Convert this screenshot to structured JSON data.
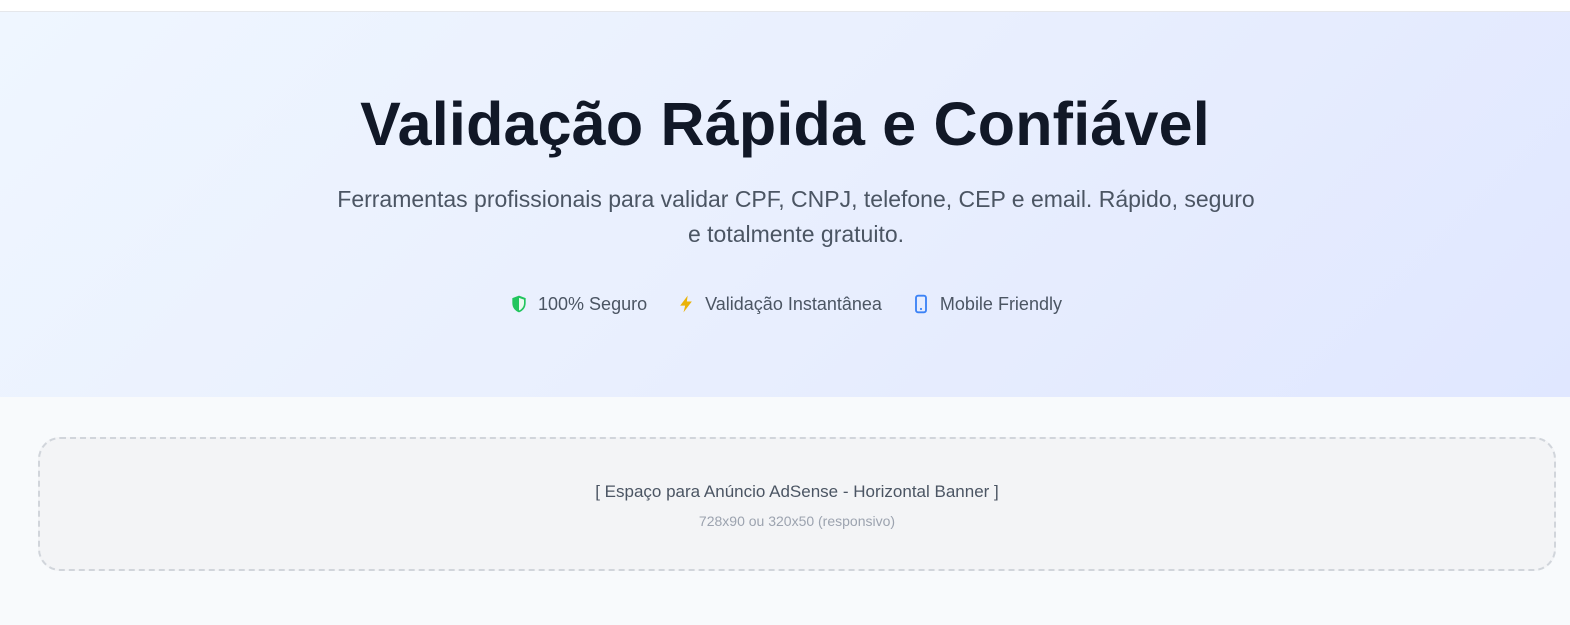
{
  "hero": {
    "title": "Validação Rápida e Confiável",
    "subtitle": "Ferramentas profissionais para validar CPF, CNPJ, telefone, CEP e email. Rápido, seguro e totalmente gratuito.",
    "features": [
      {
        "label": "100% Seguro",
        "icon": "shield-check-icon",
        "color": "#22c55e"
      },
      {
        "label": "Validação Instantânea",
        "icon": "lightning-bolt-icon",
        "color": "#eab308"
      },
      {
        "label": "Mobile Friendly",
        "icon": "smartphone-icon",
        "color": "#3b82f6"
      }
    ]
  },
  "ad": {
    "title": "[ Espaço para Anúncio AdSense - Horizontal Banner ]",
    "subtitle": "728x90 ou 320x50 (responsivo)"
  }
}
